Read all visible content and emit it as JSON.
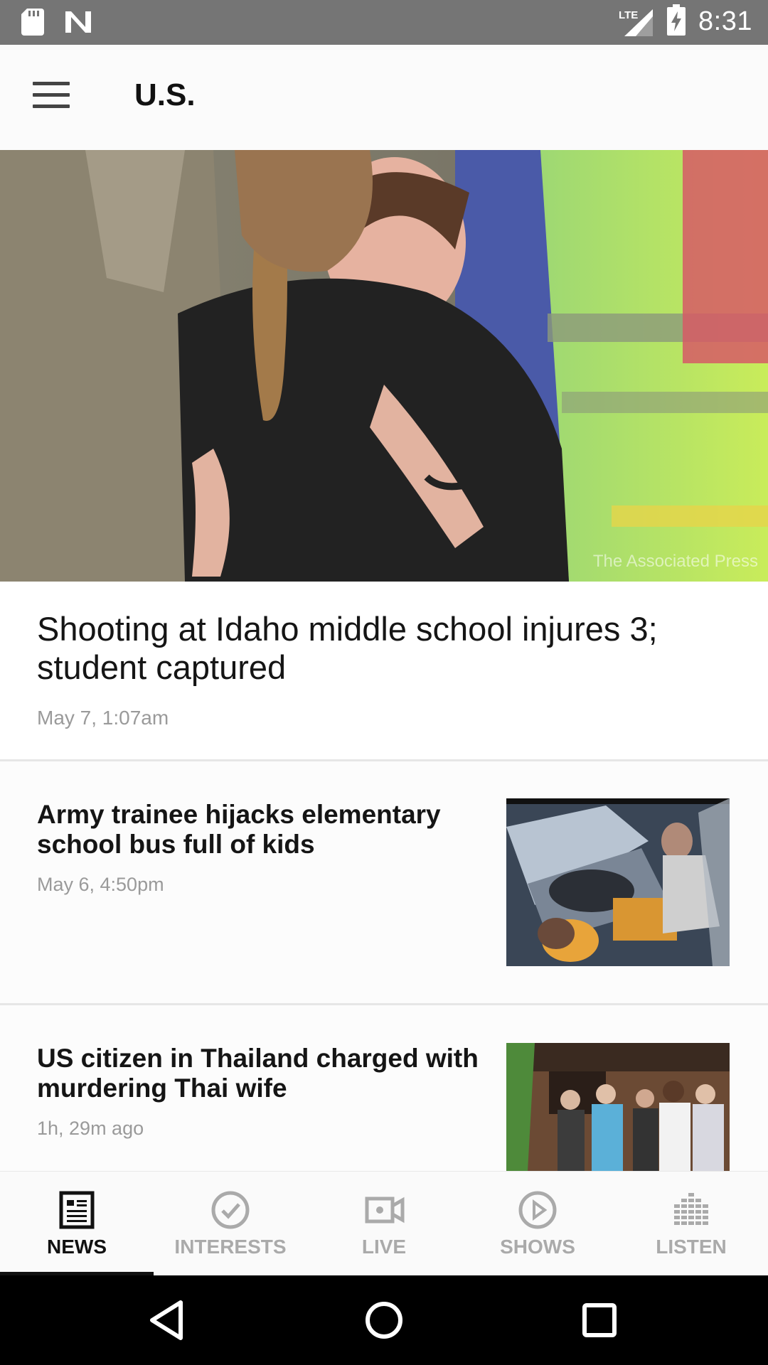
{
  "status_bar": {
    "time": "8:31",
    "network": "LTE",
    "icons": [
      "sd-card-icon",
      "n-notification-icon",
      "lte-signal-icon",
      "battery-charging-icon"
    ]
  },
  "app_bar": {
    "title": "U.S.",
    "menu_icon": "hamburger-menu-icon"
  },
  "hero": {
    "credit": "The Associated Press"
  },
  "lead_article": {
    "title": "Shooting at Idaho middle school injures 3; student captured",
    "time": "May 7, 1:07am"
  },
  "articles": [
    {
      "title": "Army trainee hijacks elementary school bus full of kids",
      "time": "May 6, 4:50pm"
    },
    {
      "title": "US citizen in Thailand charged with murdering Thai wife",
      "time": "1h, 29m ago"
    }
  ],
  "bottom_nav": {
    "items": [
      {
        "label": "NEWS",
        "icon": "newspaper-icon",
        "active": true
      },
      {
        "label": "INTERESTS",
        "icon": "check-circle-icon",
        "active": false
      },
      {
        "label": "LIVE",
        "icon": "video-camera-icon",
        "active": false
      },
      {
        "label": "SHOWS",
        "icon": "play-circle-icon",
        "active": false
      },
      {
        "label": "LISTEN",
        "icon": "equalizer-icon",
        "active": false
      }
    ]
  },
  "system_nav": {
    "icons": [
      "back-icon",
      "home-icon",
      "recents-icon"
    ]
  },
  "colors": {
    "status_bar": "#757575",
    "active_text": "#111111",
    "inactive_text": "#aaaaaa",
    "timestamp": "#9a9a9a"
  }
}
